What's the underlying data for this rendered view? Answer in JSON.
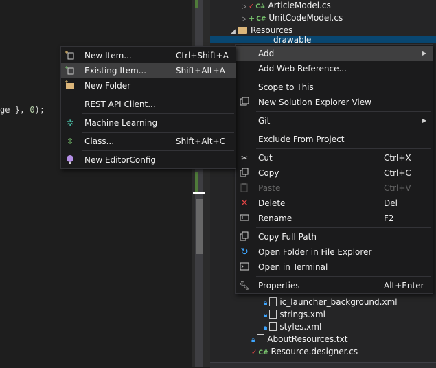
{
  "editor": {
    "code_text": "ge }, ",
    "code_num": "0",
    "code_end": ");"
  },
  "explorer": {
    "article_model": "ArticleModel.cs",
    "unit_code_model": "UnitCodeModel.cs",
    "resources": "Resources",
    "drawable": "drawable",
    "ic_launcher_background": "ic_launcher_background.xml",
    "strings": "strings.xml",
    "styles": "styles.xml",
    "about_resources": "AboutResources.txt",
    "resource_designer": "Resource.designer.cs",
    "cs_glyph": "C#"
  },
  "context_menu": {
    "items": [
      {
        "label": "Add",
        "shortcut": "",
        "submenu": true
      },
      {
        "label": "Add Web Reference...",
        "shortcut": ""
      },
      {
        "label": "Scope to This",
        "shortcut": ""
      },
      {
        "label": "New Solution Explorer View",
        "shortcut": "",
        "icon": "solution-view-icon"
      },
      {
        "label": "Git",
        "shortcut": "",
        "submenu": true
      },
      {
        "label": "Exclude From Project",
        "shortcut": ""
      },
      {
        "label": "Cut",
        "shortcut": "Ctrl+X",
        "icon": "scissors-icon"
      },
      {
        "label": "Copy",
        "shortcut": "Ctrl+C",
        "icon": "copy-icon"
      },
      {
        "label": "Paste",
        "shortcut": "Ctrl+V",
        "icon": "paste-icon",
        "disabled": true
      },
      {
        "label": "Delete",
        "shortcut": "Del",
        "icon": "delete-x-icon"
      },
      {
        "label": "Rename",
        "shortcut": "F2",
        "icon": "rename-icon"
      },
      {
        "label": "Copy Full Path",
        "shortcut": "",
        "icon": "copy-path-icon"
      },
      {
        "label": "Open Folder in File Explorer",
        "shortcut": "",
        "icon": "refresh-folder-icon"
      },
      {
        "label": "Open in Terminal",
        "shortcut": "",
        "icon": "terminal-icon"
      },
      {
        "label": "Properties",
        "shortcut": "Alt+Enter",
        "icon": "wrench-icon"
      }
    ]
  },
  "add_submenu": {
    "items": [
      {
        "label": "New Item...",
        "shortcut": "Ctrl+Shift+A",
        "icon": "new-item-icon"
      },
      {
        "label": "Existing Item...",
        "shortcut": "Shift+Alt+A",
        "icon": "existing-item-icon"
      },
      {
        "label": "New Folder",
        "shortcut": "",
        "icon": "new-folder-icon"
      },
      {
        "label": "REST API Client...",
        "shortcut": ""
      },
      {
        "label": "Machine Learning",
        "shortcut": "",
        "icon": "machine-learning-icon"
      },
      {
        "label": "Class...",
        "shortcut": "Shift+Alt+C",
        "icon": "class-icon"
      },
      {
        "label": "New EditorConfig",
        "shortcut": "",
        "icon": "editorconfig-icon"
      }
    ]
  },
  "colors": {
    "accent": "#094771",
    "menu_bg": "#1b1b1c",
    "highlight": "#3f3f40",
    "delete_red": "#e04545"
  }
}
